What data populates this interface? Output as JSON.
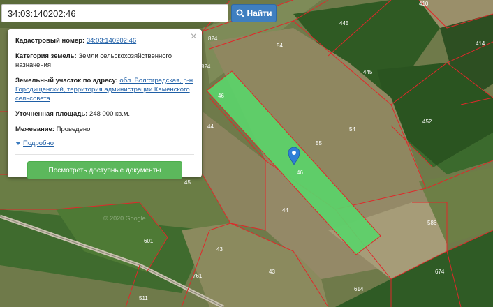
{
  "search": {
    "value": "34:03:140202:46",
    "button_label": "Найти"
  },
  "popup": {
    "cadastral_label": "Кадастровый номер:",
    "cadastral_value": "34:03:140202:46",
    "category_label": "Категория земель:",
    "category_value": "Земли сельскохозяйственного назначения",
    "address_label": "Земельный участок по адресу:",
    "address_value": "обл. Волгоградская, р-н Городищенский, территория администрации Каменского сельсовета",
    "area_label": "Уточненная площадь:",
    "area_value": "248 000 кв.м.",
    "survey_label": "Межевание:",
    "survey_value": "Проведено",
    "more_link": "Подробно",
    "docs_button": "Посмотреть доступные документы",
    "close_glyph": "×"
  },
  "map": {
    "colors": {
      "parcel_border": "#e0282a",
      "selected_fill": "#5bd26a",
      "marker": "#2f7fd6"
    },
    "parcel_labels": {
      "l410": "410",
      "l445a": "445",
      "l414": "414",
      "l824a": "824",
      "l824b": "824",
      "l54a": "54",
      "l445b": "445",
      "l46a": "46",
      "l44a": "44",
      "l54b": "54",
      "l452": "452",
      "l55": "55",
      "l46b": "46",
      "l45": "45",
      "l44b": "44",
      "l586": "586",
      "l601": "601",
      "l43a": "43",
      "l761": "761",
      "l43b": "43",
      "l674": "674",
      "l614": "614",
      "l511": "511"
    },
    "watermark": "© 2020 Google"
  }
}
